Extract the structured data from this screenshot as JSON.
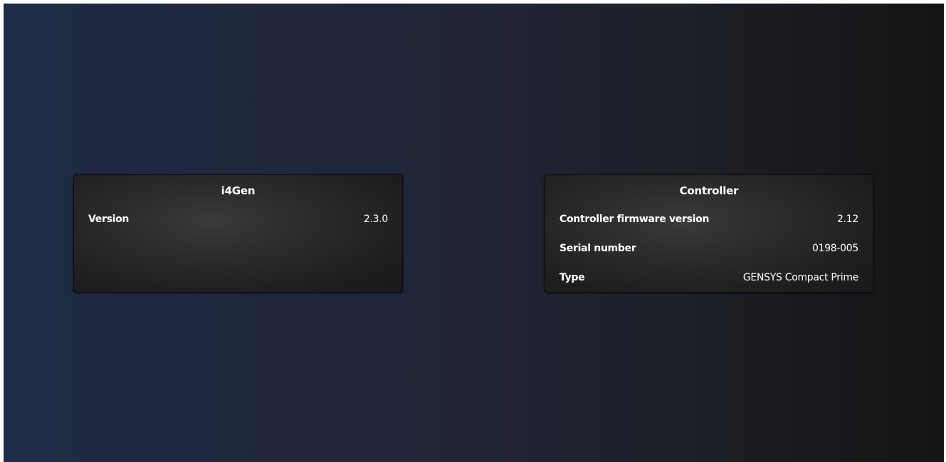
{
  "panels": [
    {
      "title": "i4Gen",
      "rows": [
        {
          "label": "Version",
          "value": "2.3.0"
        }
      ]
    },
    {
      "title": "Controller",
      "rows": [
        {
          "label": "Controller firmware version",
          "value": "2.12"
        },
        {
          "label": "Serial number",
          "value": "0198-005"
        },
        {
          "label": "Type",
          "value": "GENSYS Compact Prime"
        }
      ]
    }
  ],
  "colors": {
    "background_left": "#1f2b45",
    "background_right": "#141414",
    "card_center": "#3a3a3a",
    "card_edge": "#191919",
    "text": "#ffffff"
  }
}
